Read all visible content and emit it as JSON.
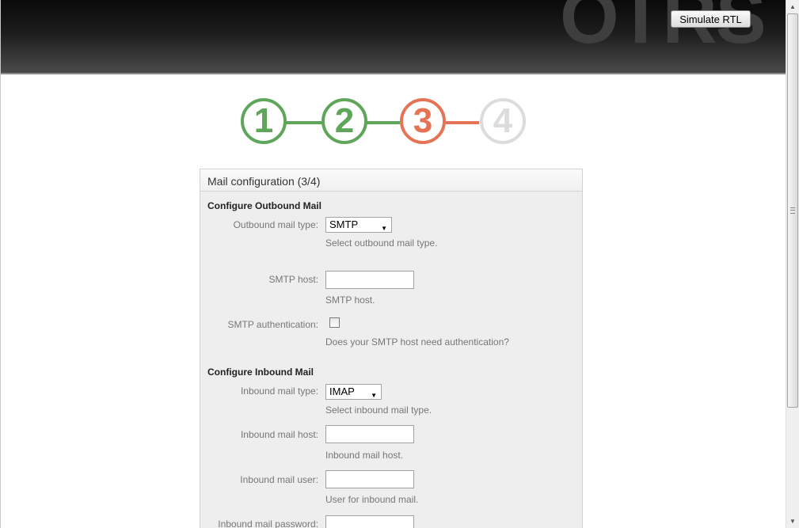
{
  "header": {
    "logo_text": "OTRS",
    "simulate_rtl_label": "Simulate RTL"
  },
  "wizard": {
    "steps": [
      {
        "number": "1",
        "state": "done",
        "color": "#5fa65a"
      },
      {
        "number": "2",
        "state": "done",
        "color": "#5fa65a"
      },
      {
        "number": "3",
        "state": "current",
        "color": "#e57356"
      },
      {
        "number": "4",
        "state": "pending",
        "color": "#dcdcdc"
      }
    ]
  },
  "panel": {
    "title": "Mail configuration (3/4)",
    "outbound": {
      "section_title": "Configure Outbound Mail",
      "mail_type_label": "Outbound mail type:",
      "mail_type_value": "SMTP",
      "mail_type_hint": "Select outbound mail type.",
      "smtp_host_label": "SMTP host:",
      "smtp_host_value": "",
      "smtp_host_hint": "SMTP host.",
      "smtp_auth_label": "SMTP authentication:",
      "smtp_auth_checked": false,
      "smtp_auth_hint": "Does your SMTP host need authentication?"
    },
    "inbound": {
      "section_title": "Configure Inbound Mail",
      "mail_type_label": "Inbound mail type:",
      "mail_type_value": "IMAP",
      "mail_type_hint": "Select inbound mail type.",
      "host_label": "Inbound mail host:",
      "host_value": "",
      "host_hint": "Inbound mail host.",
      "user_label": "Inbound mail user:",
      "user_value": "",
      "user_hint": "User for inbound mail.",
      "password_label": "Inbound mail password:",
      "password_value": ""
    }
  },
  "colors": {
    "step_done": "#5fa65a",
    "step_current": "#e57356",
    "step_pending": "#dcdcdc",
    "label_text": "#777777"
  }
}
